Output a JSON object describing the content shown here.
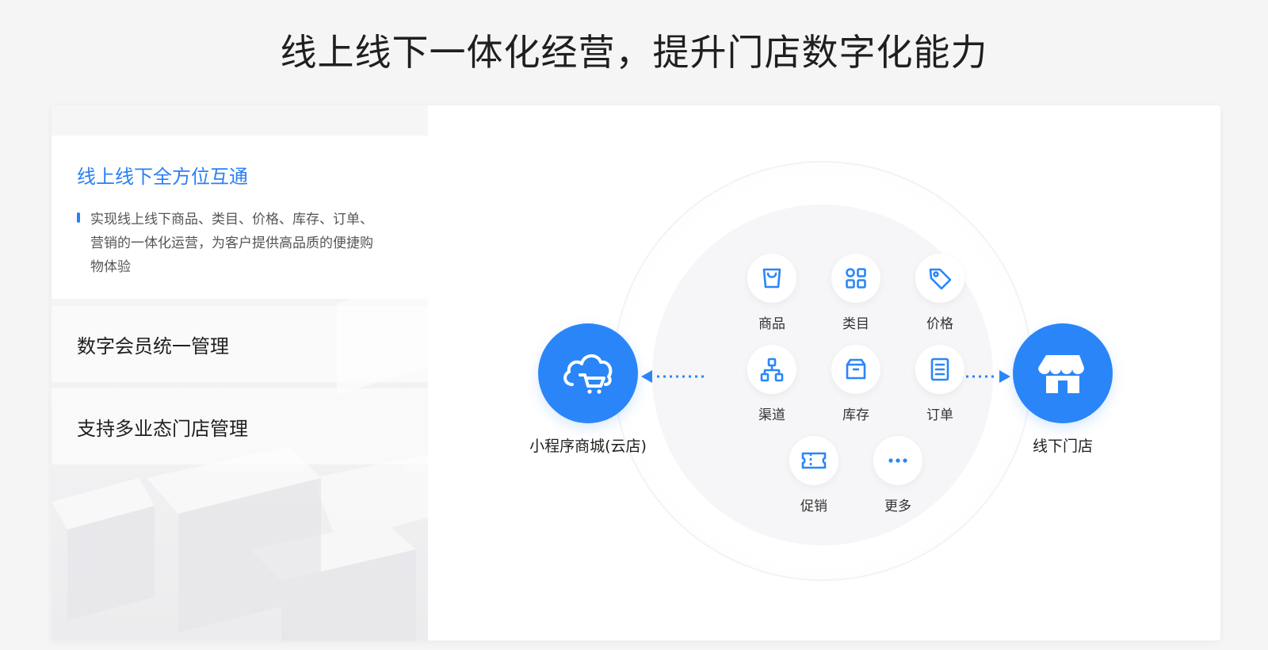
{
  "page": {
    "title": "线上线下一体化经营，提升门店数字化能力"
  },
  "features": {
    "active": {
      "title": "线上线下全方位互通",
      "description_lines": [
        "实现线上线下商品、类目、价格、库存、订单、",
        "营销的一体化运营，为客户提供高品质的便捷购",
        "物体验"
      ]
    },
    "items": [
      {
        "title": "数字会员统一管理"
      },
      {
        "title": "支持多业态门店管理"
      }
    ]
  },
  "diagram": {
    "accent_color": "#2a86f8",
    "left_hub": {
      "label": "小程序商城(云店)",
      "icon": "cloud-cart-icon"
    },
    "right_hub": {
      "label": "线下门店",
      "icon": "storefront-icon"
    },
    "modules": [
      {
        "label": "商品",
        "icon": "shopping-bag-icon"
      },
      {
        "label": "类目",
        "icon": "category-grid-icon"
      },
      {
        "label": "价格",
        "icon": "price-tag-icon"
      },
      {
        "label": "渠道",
        "icon": "channel-tree-icon"
      },
      {
        "label": "库存",
        "icon": "inventory-box-icon"
      },
      {
        "label": "订单",
        "icon": "order-doc-icon"
      },
      {
        "label": "促销",
        "icon": "coupon-icon"
      },
      {
        "label": "更多",
        "icon": "more-icon"
      }
    ]
  }
}
